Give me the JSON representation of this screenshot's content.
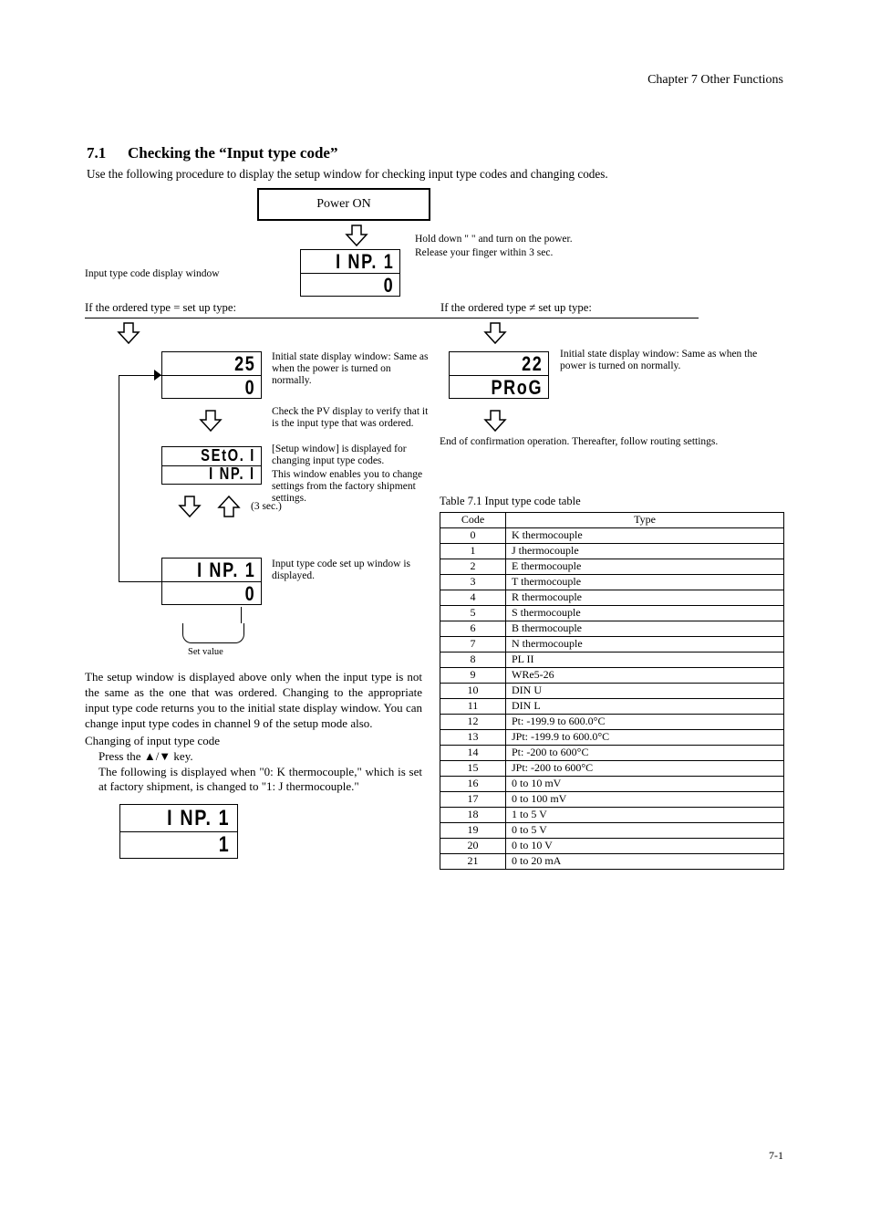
{
  "header": {
    "title": "Chapter 7  Other Functions"
  },
  "section": {
    "num": "7.1",
    "title": "Checking the “Input type code”"
  },
  "intro": "Use the following procedure to display the setup window for checking input type codes and changing codes.",
  "fig": {
    "power_on": "Power ON",
    "hold_note_a": "Hold down \" \" and turn on the power.",
    "hold_note_b": "Release your finger within 3 sec.",
    "inp1_line": "Input type code display window",
    "order_eq": "If the ordered type = set up type:",
    "order_neq": "If the ordered type ≠ set up type:",
    "init_note": "Initial state display window: Same as when the power is turned on normally.",
    "pv_check": "Check the PV display to verify that it is the input type that was ordered.",
    "end_note": "End of confirmation operation. Thereafter, follow routing settings.",
    "sp_line_1": "[Setup window] is displayed for changing input type codes.",
    "sp_line_2": "This window enables you to change settings from the factory shipment settings.",
    "inp1_set_note": "Input type code set up window is displayed.",
    "setvalue_label": "Set value",
    "para": "The setup window is displayed above only when the input type is not the same as the one that was ordered. Changing to the appropriate input type code returns you to the initial state display window. You can change input type codes in channel 9 of the setup mode also.",
    "change_title": "Changing of input type code",
    "change_press": "Press the ▲/▼ key.",
    "change_body": "The following is displayed when \"0: K thermocouple,\" which is set at factory shipment, is changed to \"1: J thermocouple.\""
  },
  "table": {
    "title": "Table 7.1 Input type code table",
    "rows": [
      {
        "code": "0",
        "type": "K thermocouple"
      },
      {
        "code": "1",
        "type": "J thermocouple"
      },
      {
        "code": "2",
        "type": "E thermocouple"
      },
      {
        "code": "3",
        "type": "T thermocouple"
      },
      {
        "code": "4",
        "type": "R thermocouple"
      },
      {
        "code": "5",
        "type": "S thermocouple"
      },
      {
        "code": "6",
        "type": "B thermocouple"
      },
      {
        "code": "7",
        "type": "N thermocouple"
      },
      {
        "code": "8",
        "type": "PL II"
      },
      {
        "code": "9",
        "type": "WRe5-26"
      },
      {
        "code": "10",
        "type": "DIN U"
      },
      {
        "code": "11",
        "type": "DIN L"
      },
      {
        "code": "12",
        "type": "Pt:   -199.9 to 600.0°C"
      },
      {
        "code": "13",
        "type": "JPt: -199.9 to 600.0°C"
      },
      {
        "code": "14",
        "type": "Pt:   -200 to 600°C"
      },
      {
        "code": "15",
        "type": "JPt: -200 to 600°C"
      },
      {
        "code": "16",
        "type": "0 to 10 mV"
      },
      {
        "code": "17",
        "type": "0 to 100 mV"
      },
      {
        "code": "18",
        "type": "1 to 5 V"
      },
      {
        "code": "19",
        "type": "0 to 5 V"
      },
      {
        "code": "20",
        "type": "0 to 10 V"
      },
      {
        "code": "21",
        "type": "0 to 20 mA"
      }
    ]
  },
  "lcd": {
    "inp1": "I NP. 1",
    "zero": "0",
    "one": "1",
    "seto1": "SEtO. I",
    "inp1b": "I NP. I",
    "twenty5": "25",
    "twenty2": "22",
    "prog": "PRoG"
  },
  "pagenum": "7-1"
}
